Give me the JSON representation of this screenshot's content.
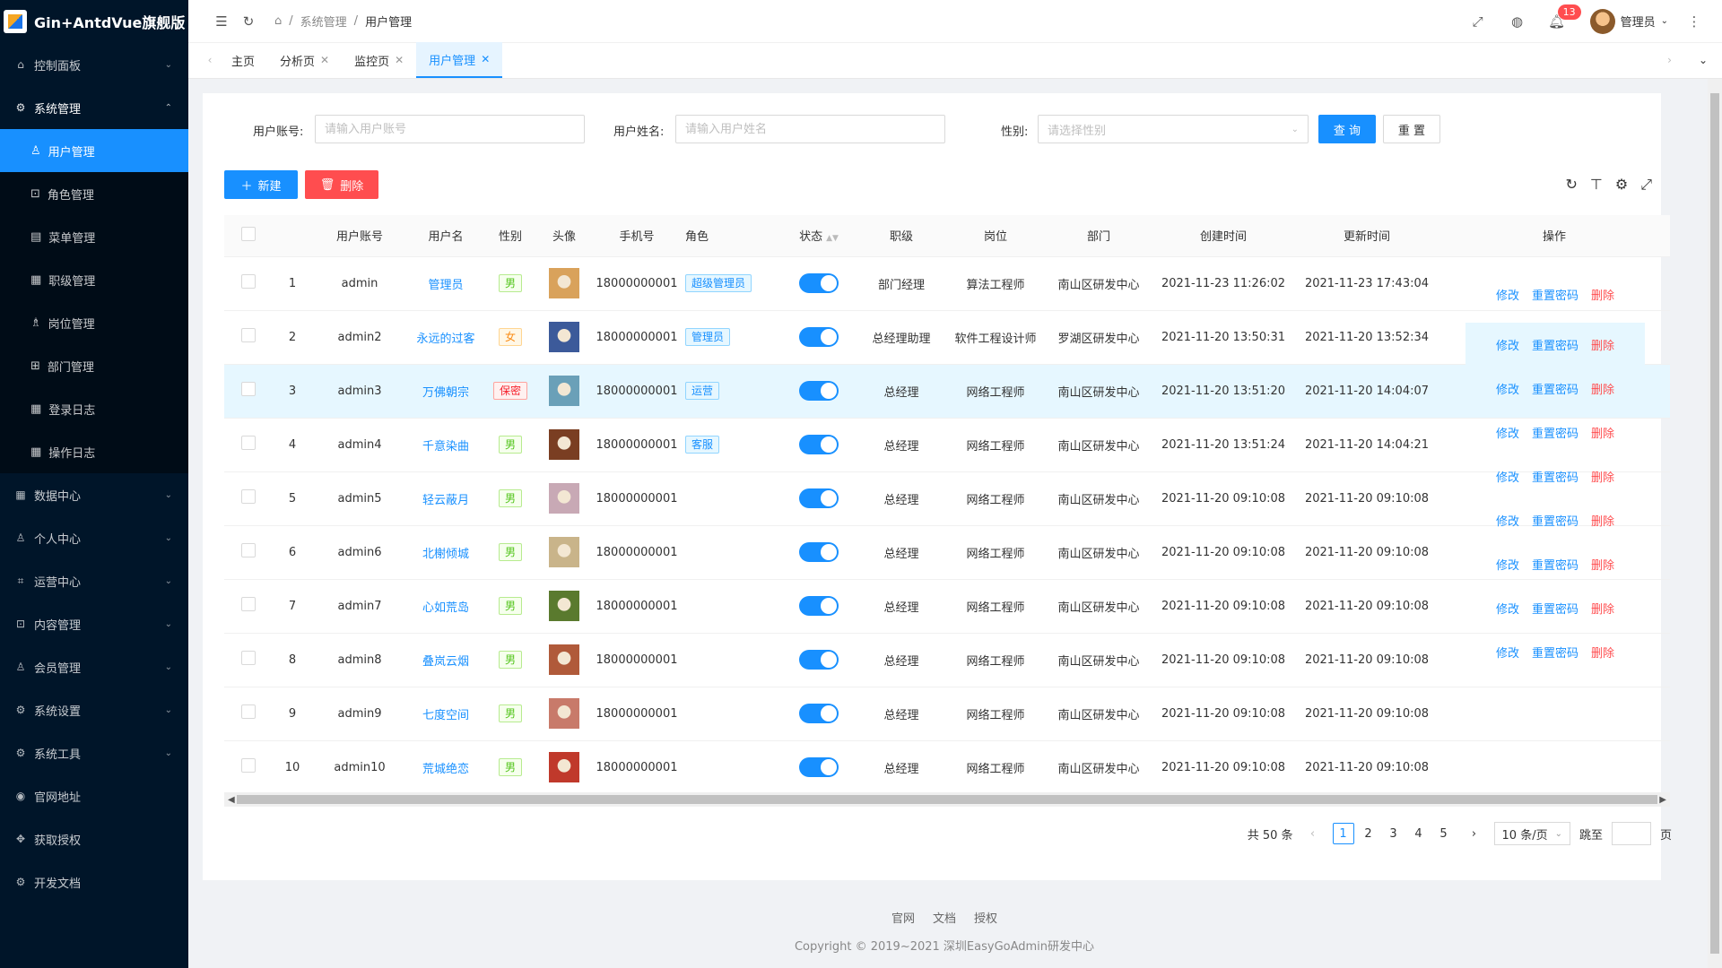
{
  "app": {
    "title": "Gin+AntdVue旗舰版"
  },
  "sidebar": {
    "items": [
      {
        "label": "控制面板",
        "icon": "⌂"
      },
      {
        "label": "系统管理",
        "icon": "⚙"
      },
      {
        "label": "数据中心",
        "icon": "▦"
      },
      {
        "label": "个人中心",
        "icon": "♙"
      },
      {
        "label": "运营中心",
        "icon": "⌗"
      },
      {
        "label": "内容管理",
        "icon": "⊡"
      },
      {
        "label": "会员管理",
        "icon": "♙"
      },
      {
        "label": "系统设置",
        "icon": "⚙"
      },
      {
        "label": "系统工具",
        "icon": "⚙"
      },
      {
        "label": "官网地址",
        "icon": "◉"
      },
      {
        "label": "获取授权",
        "icon": "✥"
      },
      {
        "label": "开发文档",
        "icon": "⚙"
      }
    ],
    "sub": [
      {
        "label": "用户管理",
        "icon": "♙"
      },
      {
        "label": "角色管理",
        "icon": "⊡"
      },
      {
        "label": "菜单管理",
        "icon": "▤"
      },
      {
        "label": "职级管理",
        "icon": "▦"
      },
      {
        "label": "岗位管理",
        "icon": "♗"
      },
      {
        "label": "部门管理",
        "icon": "⊞"
      },
      {
        "label": "登录日志",
        "icon": "▦"
      },
      {
        "label": "操作日志",
        "icon": "▦"
      }
    ]
  },
  "header": {
    "breadcrumb": [
      "系统管理",
      "用户管理"
    ],
    "notify_count": "13",
    "user": "管理员"
  },
  "tabs": [
    {
      "label": "主页",
      "closable": false
    },
    {
      "label": "分析页",
      "closable": true
    },
    {
      "label": "监控页",
      "closable": true
    },
    {
      "label": "用户管理",
      "closable": true
    }
  ],
  "search": {
    "account_label": "用户账号:",
    "account_placeholder": "请输入用户账号",
    "name_label": "用户姓名:",
    "name_placeholder": "请输入用户姓名",
    "gender_label": "性别:",
    "gender_placeholder": "请选择性别",
    "query": "查 询",
    "reset": "重 置"
  },
  "actions": {
    "add": "新建",
    "delete": "删除"
  },
  "table": {
    "columns": [
      "用户账号",
      "用户名",
      "性别",
      "头像",
      "手机号",
      "角色",
      "状态",
      "职级",
      "岗位",
      "部门",
      "创建时间",
      "更新时间",
      "操作"
    ],
    "rows": [
      {
        "no": "1",
        "account": "admin",
        "name": "管理员",
        "gender": "男",
        "gtype": "male",
        "avatar": "#d9a25b",
        "phone": "18000000001",
        "role": "超级管理员",
        "level": "部门经理",
        "post": "算法工程师",
        "dept": "南山区研发中心",
        "created": "2021-11-23 11:26:02",
        "updated": "2021-11-23 17:43:04"
      },
      {
        "no": "2",
        "account": "admin2",
        "name": "永远的过客",
        "gender": "女",
        "gtype": "female",
        "avatar": "#3c5a9a",
        "phone": "18000000001",
        "role": "管理员",
        "level": "总经理助理",
        "post": "软件工程设计师",
        "dept": "罗湖区研发中心",
        "created": "2021-11-20 13:50:31",
        "updated": "2021-11-20 13:52:34"
      },
      {
        "no": "3",
        "account": "admin3",
        "name": "万佛朝宗",
        "gender": "保密",
        "gtype": "secret",
        "avatar": "#6aa0b8",
        "phone": "18000000001",
        "role": "运营",
        "level": "总经理",
        "post": "网络工程师",
        "dept": "南山区研发中心",
        "created": "2021-11-20 13:51:20",
        "updated": "2021-11-20 14:04:07"
      },
      {
        "no": "4",
        "account": "admin4",
        "name": "千意染曲",
        "gender": "男",
        "gtype": "male",
        "avatar": "#7a3e22",
        "phone": "18000000001",
        "role": "客服",
        "level": "总经理",
        "post": "网络工程师",
        "dept": "南山区研发中心",
        "created": "2021-11-20 13:51:24",
        "updated": "2021-11-20 14:04:21"
      },
      {
        "no": "5",
        "account": "admin5",
        "name": "轻云蔽月",
        "gender": "男",
        "gtype": "male",
        "avatar": "#c8a9b5",
        "phone": "18000000001",
        "role": "",
        "level": "总经理",
        "post": "网络工程师",
        "dept": "南山区研发中心",
        "created": "2021-11-20 09:10:08",
        "updated": "2021-11-20 09:10:08"
      },
      {
        "no": "6",
        "account": "admin6",
        "name": "北榭倾城",
        "gender": "男",
        "gtype": "male",
        "avatar": "#c9b48a",
        "phone": "18000000001",
        "role": "",
        "level": "总经理",
        "post": "网络工程师",
        "dept": "南山区研发中心",
        "created": "2021-11-20 09:10:08",
        "updated": "2021-11-20 09:10:08"
      },
      {
        "no": "7",
        "account": "admin7",
        "name": "心如荒岛",
        "gender": "男",
        "gtype": "male",
        "avatar": "#5a7a2e",
        "phone": "18000000001",
        "role": "",
        "level": "总经理",
        "post": "网络工程师",
        "dept": "南山区研发中心",
        "created": "2021-11-20 09:10:08",
        "updated": "2021-11-20 09:10:08"
      },
      {
        "no": "8",
        "account": "admin8",
        "name": "叠岚云烟",
        "gender": "男",
        "gtype": "male",
        "avatar": "#b05a3a",
        "phone": "18000000001",
        "role": "",
        "level": "总经理",
        "post": "网络工程师",
        "dept": "南山区研发中心",
        "created": "2021-11-20 09:10:08",
        "updated": "2021-11-20 09:10:08"
      },
      {
        "no": "9",
        "account": "admin9",
        "name": "七度空间",
        "gender": "男",
        "gtype": "male",
        "avatar": "#c87a6a",
        "phone": "18000000001",
        "role": "",
        "level": "总经理",
        "post": "网络工程师",
        "dept": "南山区研发中心",
        "created": "2021-11-20 09:10:08",
        "updated": "2021-11-20 09:10:08"
      },
      {
        "no": "10",
        "account": "admin10",
        "name": "荒城绝恋",
        "gender": "男",
        "gtype": "male",
        "avatar": "#c0392b",
        "phone": "18000000001",
        "role": "",
        "level": "总经理",
        "post": "网络工程师",
        "dept": "南山区研发中心",
        "created": "2021-11-20 09:10:08",
        "updated": "2021-11-20 09:10:08"
      }
    ],
    "ops": {
      "edit": "修改",
      "reset_pwd": "重置密码",
      "delete": "删除"
    }
  },
  "pagination": {
    "total": "共 50 条",
    "pages": [
      "1",
      "2",
      "3",
      "4",
      "5"
    ],
    "page_size": "10 条/页",
    "jump_label": "跳至",
    "page_suffix": "页"
  },
  "footer": {
    "links": [
      "官网",
      "文档",
      "授权"
    ],
    "copyright": "Copyright © 2019~2021 深圳EasyGoAdmin研发中心"
  },
  "colors": {
    "primary": "#1890ff",
    "danger": "#ff4d4f",
    "sidebar": "#001529"
  }
}
